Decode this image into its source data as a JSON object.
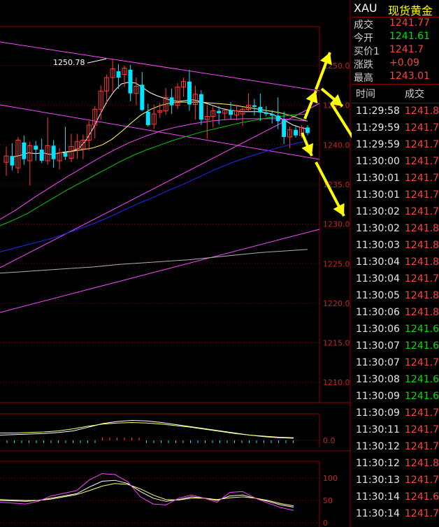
{
  "chart_data": {
    "type": "candlestick",
    "title": "",
    "y_ticks": [
      1250.0,
      1245.0,
      1240.0,
      1235.0,
      1230.0,
      1225.0,
      1220.0,
      1215.0,
      1210.0
    ],
    "ylim": [
      1206.6,
      1253.3
    ],
    "annotations": [
      {
        "text": "1250.78",
        "price": 1250.78
      }
    ],
    "candles": [
      [
        1237.8,
        1239.8,
        1236.1,
        1238.6
      ],
      [
        1238.6,
        1240.2,
        1236.8,
        1237.4
      ],
      [
        1237.1,
        1241.0,
        1236.4,
        1240.6
      ],
      [
        1240.3,
        1241.2,
        1237.5,
        1238.2
      ],
      [
        1238.0,
        1240.4,
        1234.9,
        1239.9
      ],
      [
        1239.9,
        1240.5,
        1238.0,
        1239.4
      ],
      [
        1239.4,
        1240.8,
        1237.7,
        1238.0
      ],
      [
        1238.0,
        1243.5,
        1237.5,
        1239.9
      ],
      [
        1239.9,
        1240.6,
        1237.1,
        1238.2
      ],
      [
        1238.0,
        1239.6,
        1236.9,
        1239.0
      ],
      [
        1239.0,
        1242.3,
        1238.1,
        1238.5
      ],
      [
        1238.3,
        1241.4,
        1237.8,
        1239.8
      ],
      [
        1239.5,
        1241.4,
        1238.2,
        1240.4
      ],
      [
        1239.5,
        1241.3,
        1238.2,
        1240.6
      ],
      [
        1240.6,
        1243.0,
        1239.3,
        1242.5
      ],
      [
        1242.5,
        1244.9,
        1240.8,
        1244.5
      ],
      [
        1244.5,
        1247.5,
        1243.2,
        1246.8
      ],
      [
        1246.8,
        1248.9,
        1245.2,
        1248.5
      ],
      [
        1248.5,
        1250.8,
        1246.7,
        1249.6
      ],
      [
        1249.3,
        1250.2,
        1247.1,
        1248.5
      ],
      [
        1248.9,
        1250.0,
        1247.3,
        1249.7
      ],
      [
        1249.5,
        1250.1,
        1245.5,
        1246.5
      ],
      [
        1246.5,
        1248.5,
        1245.0,
        1247.4
      ],
      [
        1247.6,
        1249.2,
        1244.3,
        1244.4
      ],
      [
        1244.2,
        1245.2,
        1242.3,
        1242.5
      ],
      [
        1242.6,
        1245.1,
        1242.0,
        1243.9
      ],
      [
        1244.1,
        1245.3,
        1243.4,
        1244.3
      ],
      [
        1244.3,
        1247.2,
        1243.8,
        1246.0
      ],
      [
        1246.0,
        1247.1,
        1243.9,
        1245.0
      ],
      [
        1245.0,
        1247.8,
        1244.5,
        1247.3
      ],
      [
        1247.3,
        1248.5,
        1246.1,
        1248.0
      ],
      [
        1248.0,
        1249.5,
        1244.3,
        1245.1
      ],
      [
        1245.1,
        1247.5,
        1243.2,
        1246.4
      ],
      [
        1246.4,
        1246.9,
        1242.5,
        1243.2
      ],
      [
        1243.2,
        1245.0,
        1240.8,
        1243.6
      ],
      [
        1243.6,
        1244.9,
        1242.2,
        1244.3
      ],
      [
        1244.3,
        1244.9,
        1242.6,
        1244.0
      ],
      [
        1244.0,
        1244.5,
        1243.2,
        1244.4
      ],
      [
        1244.4,
        1245.4,
        1243.2,
        1243.8
      ],
      [
        1243.8,
        1245.1,
        1243.1,
        1244.3
      ],
      [
        1243.9,
        1244.8,
        1242.4,
        1244.5
      ],
      [
        1244.5,
        1246.5,
        1244.2,
        1245.0
      ],
      [
        1245.0,
        1245.8,
        1243.7,
        1244.8
      ],
      [
        1244.8,
        1246.5,
        1243.0,
        1244.1
      ],
      [
        1244.1,
        1244.9,
        1243.6,
        1243.9
      ],
      [
        1243.9,
        1244.4,
        1242.7,
        1243.7
      ],
      [
        1243.7,
        1246.0,
        1242.0,
        1243.0
      ],
      [
        1243.2,
        1244.2,
        1240.1,
        1241.0
      ],
      [
        1241.0,
        1242.3,
        1239.6,
        1241.9
      ],
      [
        1241.9,
        1242.5,
        1240.9,
        1241.2
      ],
      [
        1241.2,
        1242.5,
        1240.9,
        1242.2
      ],
      [
        1242.2,
        1242.5,
        1241.2,
        1241.5
      ]
    ],
    "ma_series": [
      {
        "color": "#ffffff",
        "values": [
          1238.5,
          1238.7,
          1239.0,
          1238.9,
          1239.0,
          1238.8,
          1238.9,
          1239.1,
          1239.2,
          1239.5,
          1240.5,
          1242.0,
          1243.8,
          1245.5,
          1246.8,
          1247.7,
          1247.9,
          1247.8,
          1247.2,
          1246.6,
          1246.2,
          1245.9,
          1245.6,
          1245.5,
          1245.6,
          1245.7,
          1245.5,
          1245.2,
          1244.9,
          1244.6,
          1244.4,
          1244.3,
          1244.2,
          1244.2,
          1244.2,
          1244.1,
          1243.9,
          1243.5,
          1243.0,
          1242.5,
          1242.2,
          1242.0
        ]
      },
      {
        "color": "#ffff66",
        "values": [
          1239.0,
          1239.2,
          1239.4,
          1239.6,
          1240.0,
          1240.7,
          1241.7,
          1242.8,
          1243.8,
          1244.5,
          1245.0,
          1245.3,
          1245.4,
          1245.4,
          1245.4,
          1245.3,
          1245.2,
          1245.1,
          1244.9,
          1244.7,
          1244.5,
          1244.3,
          1244.1,
          1243.8,
          1243.4,
          1243.0
        ]
      },
      {
        "color": "#ff44ff",
        "values": [
          1230.6,
          1231.8,
          1233.2,
          1234.5,
          1235.8,
          1237.0,
          1238.2,
          1239.3,
          1240.3,
          1241.1,
          1241.8,
          1242.3,
          1242.7,
          1243.0,
          1243.2,
          1243.3,
          1243.3,
          1243.3,
          1243.2,
          1243.0
        ]
      },
      {
        "color": "#00cc00",
        "values": [
          1229.8,
          1230.5,
          1231.3,
          1232.3,
          1233.3,
          1234.3,
          1235.2,
          1236.1,
          1237.0,
          1237.9,
          1238.7,
          1239.4,
          1240.0,
          1240.6,
          1241.1,
          1241.6,
          1242.0,
          1242.4,
          1242.8,
          1243.1,
          1243.4,
          1243.6,
          1243.8,
          1243.9
        ]
      },
      {
        "color": "#1d2bff",
        "values": [
          1226.5,
          1227.0,
          1227.5,
          1228.0,
          1228.6,
          1229.3,
          1230.0,
          1230.8,
          1231.7,
          1232.6,
          1233.4,
          1234.3,
          1235.1,
          1236.0,
          1236.9,
          1237.7,
          1238.4,
          1239.0,
          1239.6,
          1240.1,
          1240.5
        ]
      },
      {
        "color": "#b0b0b0",
        "values": [
          1223.8,
          1224.0,
          1224.2,
          1224.4,
          1224.6,
          1224.9,
          1225.1,
          1225.3,
          1225.5,
          1225.8,
          1226.1,
          1226.4,
          1226.6,
          1226.8
        ]
      }
    ],
    "macd": {
      "y_ticks": [
        0.0
      ],
      "dif": [
        0.1,
        0.11,
        0.12,
        0.13,
        0.15,
        0.18,
        0.25,
        0.32,
        0.36,
        0.38,
        0.37,
        0.34,
        0.3,
        0.26,
        0.22,
        0.18,
        0.14,
        0.1,
        0.07,
        0.05,
        0.04
      ],
      "dea": [
        0.14,
        0.14,
        0.15,
        0.16,
        0.18,
        0.22,
        0.27,
        0.31,
        0.33,
        0.34,
        0.33,
        0.31,
        0.28,
        0.25,
        0.21,
        0.17,
        0.13,
        0.1,
        0.08,
        0.06,
        0.05
      ]
    },
    "kdj": {
      "y_ticks": [
        100,
        50,
        0
      ],
      "k": [
        50,
        49,
        48,
        50,
        55,
        60,
        65,
        80,
        93,
        95,
        88,
        70,
        55,
        48,
        52,
        58,
        55,
        50,
        60,
        62,
        55,
        48,
        40,
        35
      ],
      "d": [
        52,
        51,
        50,
        50,
        53,
        58,
        63,
        72,
        82,
        88,
        86,
        76,
        62,
        52,
        51,
        55,
        55,
        52,
        56,
        58,
        55,
        50,
        43,
        38
      ],
      "j": [
        46,
        44,
        42,
        48,
        60,
        66,
        72,
        96,
        110,
        108,
        92,
        58,
        42,
        40,
        55,
        62,
        55,
        46,
        68,
        70,
        55,
        44,
        34,
        28
      ]
    }
  },
  "panel": {
    "symbol": "XAU",
    "name": "现货黄金",
    "quotes": [
      {
        "label": "成交",
        "value": "1241.77",
        "color": "#ff4040"
      },
      {
        "label": "今开",
        "value": "1241.61",
        "color": "#00e000"
      },
      {
        "label": "买价1",
        "value": "1241.7",
        "color": "#ff4040"
      },
      {
        "label": "涨跌",
        "value": "+0.09",
        "color": "#ff4040"
      },
      {
        "label": "最高",
        "value": "1243.01",
        "color": "#ff4040"
      }
    ],
    "time_header": "时间",
    "deal_header": "成交",
    "ticks": [
      {
        "time": "11:29:58",
        "price": "1241.8",
        "dir": "up"
      },
      {
        "time": "11:29:59",
        "price": "1241.7",
        "dir": "up"
      },
      {
        "time": "11:29:59",
        "price": "1241.7",
        "dir": "up"
      },
      {
        "time": "11:30:00",
        "price": "1241.7",
        "dir": "up"
      },
      {
        "time": "11:30:01",
        "price": "1241.7",
        "dir": "up"
      },
      {
        "time": "11:30:01",
        "price": "1241.7",
        "dir": "up"
      },
      {
        "time": "11:30:02",
        "price": "1241.7",
        "dir": "up"
      },
      {
        "time": "11:30:02",
        "price": "1241.8",
        "dir": "up"
      },
      {
        "time": "11:30:03",
        "price": "1241.8",
        "dir": "up"
      },
      {
        "time": "11:30:04",
        "price": "1241.8",
        "dir": "up"
      },
      {
        "time": "11:30:04",
        "price": "1241.7",
        "dir": "up"
      },
      {
        "time": "11:30:05",
        "price": "1241.8",
        "dir": "up"
      },
      {
        "time": "11:30:06",
        "price": "1241.8",
        "dir": "up"
      },
      {
        "time": "11:30:06",
        "price": "1241.6",
        "dir": "down"
      },
      {
        "time": "11:30:07",
        "price": "1241.6",
        "dir": "down"
      },
      {
        "time": "11:30:07",
        "price": "1241.7",
        "dir": "up"
      },
      {
        "time": "11:30:08",
        "price": "1241.6",
        "dir": "down"
      },
      {
        "time": "11:30:09",
        "price": "1241.6",
        "dir": "down"
      },
      {
        "time": "11:30:09",
        "price": "1241.7",
        "dir": "up"
      },
      {
        "time": "11:30:11",
        "price": "1241.7",
        "dir": "up"
      },
      {
        "time": "11:30:12",
        "price": "1241.7",
        "dir": "up"
      },
      {
        "time": "11:30:12",
        "price": "1241.8",
        "dir": "up"
      },
      {
        "time": "11:30:13",
        "price": "1241.7",
        "dir": "up"
      },
      {
        "time": "11:30:14",
        "price": "1241.6",
        "dir": "up"
      },
      {
        "time": "11:30:14",
        "price": "1241.7",
        "dir": "up"
      }
    ]
  }
}
